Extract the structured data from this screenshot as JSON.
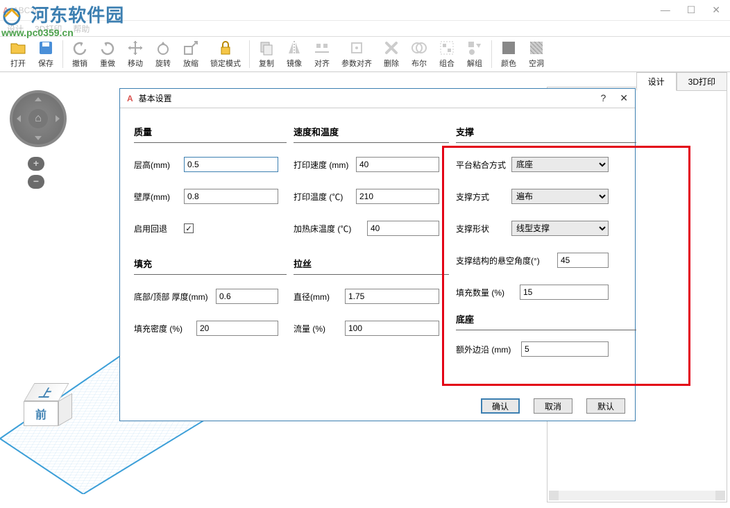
{
  "window": {
    "title": "ABC3D"
  },
  "watermark": {
    "line1": "河东软件园",
    "line2": "www.pc0359.cn"
  },
  "menu": {
    "items": [
      "设计",
      "3D打印",
      "帮助"
    ]
  },
  "toolbar": {
    "items": [
      {
        "label": "打开",
        "icon": "open"
      },
      {
        "label": "保存",
        "icon": "save"
      },
      {
        "sep": true
      },
      {
        "label": "撤销",
        "icon": "undo"
      },
      {
        "label": "重做",
        "icon": "redo"
      },
      {
        "label": "移动",
        "icon": "move"
      },
      {
        "label": "旋转",
        "icon": "rotate"
      },
      {
        "label": "放缩",
        "icon": "scale"
      },
      {
        "label": "锁定模式",
        "icon": "lock"
      },
      {
        "sep": true
      },
      {
        "label": "复制",
        "icon": "copy"
      },
      {
        "label": "镜像",
        "icon": "mirror"
      },
      {
        "label": "对齐",
        "icon": "align"
      },
      {
        "label": "参数对齐",
        "icon": "param-align"
      },
      {
        "label": "删除",
        "icon": "delete"
      },
      {
        "label": "布尔",
        "icon": "boolean"
      },
      {
        "label": "组合",
        "icon": "group"
      },
      {
        "label": "解组",
        "icon": "ungroup"
      },
      {
        "sep": true
      },
      {
        "label": "颜色",
        "icon": "color"
      },
      {
        "label": "空洞",
        "icon": "hole"
      }
    ]
  },
  "tabs": {
    "design": "设计",
    "print3d": "3D打印"
  },
  "viewcube": {
    "top": "上",
    "front": "前"
  },
  "dialog": {
    "title": "基本设置",
    "sections": {
      "quality": "质量",
      "speed_temp": "速度和温度",
      "support": "支撑",
      "fill": "填充",
      "filament": "拉丝",
      "raft": "底座"
    },
    "fields": {
      "layer_height": {
        "label": "层高(mm)",
        "value": "0.5"
      },
      "wall_thickness": {
        "label": "壁厚(mm)",
        "value": "0.8"
      },
      "retraction": {
        "label": "启用回退",
        "value": "✓"
      },
      "bottom_top_thickness": {
        "label": "底部/顶部 厚度(mm)",
        "value": "0.6"
      },
      "fill_density": {
        "label": "填充密度 (%)",
        "value": "20"
      },
      "print_speed": {
        "label": "打印速度 (mm)",
        "value": "40"
      },
      "print_temp": {
        "label": "打印温度 (℃)",
        "value": "210"
      },
      "bed_temp": {
        "label": "加热床温度 (℃)",
        "value": "40"
      },
      "diameter": {
        "label": "直径(mm)",
        "value": "1.75"
      },
      "flow": {
        "label": "流量 (%)",
        "value": "100"
      },
      "adhesion": {
        "label": "平台粘合方式",
        "value": "底座"
      },
      "support_type": {
        "label": "支撑方式",
        "value": "遍布"
      },
      "support_shape": {
        "label": "支撑形状",
        "value": "线型支撑"
      },
      "overhang_angle": {
        "label": "支撑结构的悬空角度(°)",
        "value": "45"
      },
      "fill_amount": {
        "label": "填充数量 (%)",
        "value": "15"
      },
      "extra_margin": {
        "label": "额外边沿 (mm)",
        "value": "5"
      }
    },
    "buttons": {
      "ok": "确认",
      "cancel": "取消",
      "default": "默认"
    }
  }
}
